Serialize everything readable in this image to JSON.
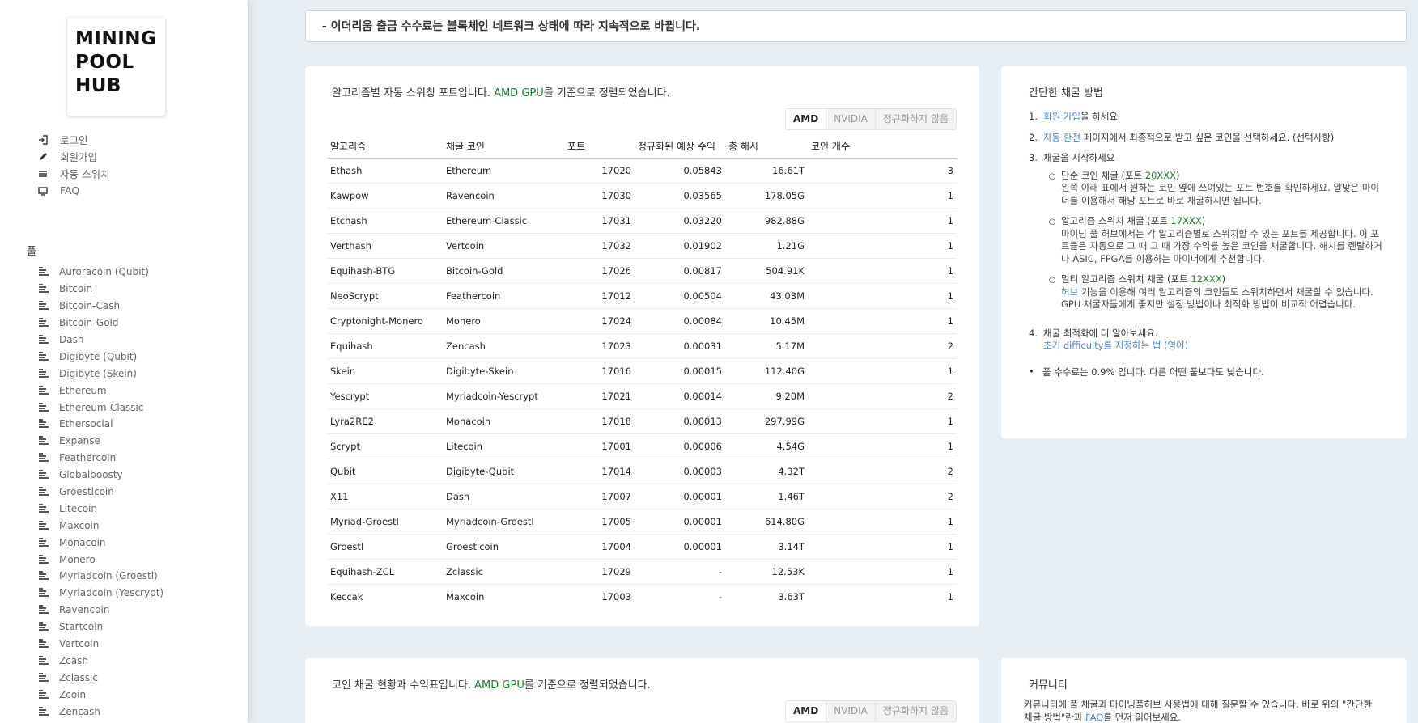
{
  "logo": {
    "lines": [
      "MINING",
      "POOL",
      "HUB"
    ]
  },
  "nav": [
    {
      "label": "로그인",
      "icon": "login-icon"
    },
    {
      "label": "회원가입",
      "icon": "pencil-icon"
    },
    {
      "label": "자동 스위치",
      "icon": "switch-icon"
    },
    {
      "label": "FAQ",
      "icon": "monitor-icon"
    }
  ],
  "pool": {
    "heading": "풀",
    "items": [
      "Auroracoin (Qubit)",
      "Bitcoin",
      "Bitcoin-Cash",
      "Bitcoin-Gold",
      "Dash",
      "Digibyte (Qubit)",
      "Digibyte (Skein)",
      "Ethereum",
      "Ethereum-Classic",
      "Ethersocial",
      "Expanse",
      "Feathercoin",
      "Globalboosty",
      "Groestlcoin",
      "Litecoin",
      "Maxcoin",
      "Monacoin",
      "Monero",
      "Myriadcoin (Groestl)",
      "Myriadcoin (Yescrypt)",
      "Ravencoin",
      "Startcoin",
      "Vertcoin",
      "Zcash",
      "Zclassic",
      "Zcoin",
      "Zencash"
    ]
  },
  "notice": "- 이더리움 출금 수수료는 블록체인 네트워크 상태에 따라 지속적으로 바뀝니다.",
  "algo": {
    "title_pre": "알고리즘별 자동 스위칭 포트입니다. ",
    "title_green": "AMD GPU",
    "title_post": "를 기준으로 정렬되었습니다.",
    "toggles": [
      "AMD",
      "NVIDIA",
      "정규화하지 않음"
    ],
    "headers": [
      "알고리즘",
      "채굴 코인",
      "포트",
      "정규화된 예상 수익",
      "총 해시",
      "코인 개수"
    ],
    "rows": [
      [
        "Ethash",
        "Ethereum",
        "17020",
        "0.05843",
        "16.61T",
        "3"
      ],
      [
        "Kawpow",
        "Ravencoin",
        "17030",
        "0.03565",
        "178.05G",
        "1"
      ],
      [
        "Etchash",
        "Ethereum-Classic",
        "17031",
        "0.03220",
        "982.88G",
        "1"
      ],
      [
        "Verthash",
        "Vertcoin",
        "17032",
        "0.01902",
        "1.21G",
        "1"
      ],
      [
        "Equihash-BTG",
        "Bitcoin-Gold",
        "17026",
        "0.00817",
        "504.91K",
        "1"
      ],
      [
        "NeoScrypt",
        "Feathercoin",
        "17012",
        "0.00504",
        "43.03M",
        "1"
      ],
      [
        "Cryptonight-Monero",
        "Monero",
        "17024",
        "0.00084",
        "10.45M",
        "1"
      ],
      [
        "Equihash",
        "Zencash",
        "17023",
        "0.00031",
        "5.17M",
        "2"
      ],
      [
        "Skein",
        "Digibyte-Skein",
        "17016",
        "0.00015",
        "112.40G",
        "1"
      ],
      [
        "Yescrypt",
        "Myriadcoin-Yescrypt",
        "17021",
        "0.00014",
        "9.20M",
        "2"
      ],
      [
        "Lyra2RE2",
        "Monacoin",
        "17018",
        "0.00013",
        "297.99G",
        "1"
      ],
      [
        "Scrypt",
        "Litecoin",
        "17001",
        "0.00006",
        "4.54G",
        "1"
      ],
      [
        "Qubit",
        "Digibyte-Qubit",
        "17014",
        "0.00003",
        "4.32T",
        "2"
      ],
      [
        "X11",
        "Dash",
        "17007",
        "0.00001",
        "1.46T",
        "2"
      ],
      [
        "Myriad-Groestl",
        "Myriadcoin-Groestl",
        "17005",
        "0.00001",
        "614.80G",
        "1"
      ],
      [
        "Groestl",
        "Groestlcoin",
        "17004",
        "0.00001",
        "3.14T",
        "1"
      ],
      [
        "Equihash-ZCL",
        "Zclassic",
        "17029",
        "-",
        "12.53K",
        "1"
      ],
      [
        "Keccak",
        "Maxcoin",
        "17003",
        "-",
        "3.63T",
        "1"
      ]
    ]
  },
  "howto": {
    "title": "간단한 채굴 방법",
    "step1_link": "회원 가입",
    "step1_text": "을 하세요",
    "step2_link": "자동 환전",
    "step2_text": " 페이지에서 최종적으로 받고 싶은 코인을 선택하세요. (선택사항)",
    "step3_text": "채굴을 시작하세요",
    "sub1_title": "단순 코인 채굴 (포트 ",
    "sub1_port": "20XXX",
    "sub1_close": ")",
    "sub1_desc": "왼쪽 아래 표에서 원하는 코인 옆에 쓰여있는 포트 번호를 확인하세요. 알맞은 마이너를 이용해서 해당 포트로 바로 채굴하시면 됩니다.",
    "sub2_title": "알고리즘 스위치 채굴 (포트 ",
    "sub2_port": "17XXX",
    "sub2_close": ")",
    "sub2_desc": "마이닝 풀 허브에서는 각 알고리즘별로 스위치할 수 있는 포트를 제공합니다. 이 포트들은 자동으로 그 때 그 때 가장 수익률 높은 코인을 채굴합니다. 해시를 렌탈하거나 ASIC, FPGA를 이용하는 마이너에게 추천합니다.",
    "sub3_title": "멀티 알고리즘 스위치 채굴 (포트 ",
    "sub3_port": "12XXX",
    "sub3_close": ")",
    "sub3_link": "허브",
    "sub3_desc": " 기능을 이용해 여러 알고리즘의 코인들도 스위치하면서 채굴할 수 있습니다. GPU 채굴자들에게 좋지만 설정 방법이나 최적화 방법이 비교적 어렵습니다.",
    "step4_text": "채굴 최적화에 더 알아보세요.",
    "step4_link": "초기 difficulty를 지정하는 법 (영어)",
    "fee": "풀 수수료는 0.9% 입니다. 다른 어떤 풀보다도 낮습니다."
  },
  "coin": {
    "title_pre": "코인 채굴 현황과 수익표입니다. ",
    "title_green": "AMD GPU",
    "title_post": "를 기준으로 정렬되었습니다.",
    "toggles": [
      "AMD",
      "NVIDIA",
      "정규화하지 않음"
    ]
  },
  "community": {
    "title": "커뮤니티",
    "text_pre": "커뮤니티에 풀 채굴과 마이닝풀허브 사용법에 대해 질문할 수 있습니다. 바로 위의 \"간단한 채굴 방법\"란과 ",
    "faq": "FAQ",
    "text_post": "를 먼저 읽어보세요."
  }
}
